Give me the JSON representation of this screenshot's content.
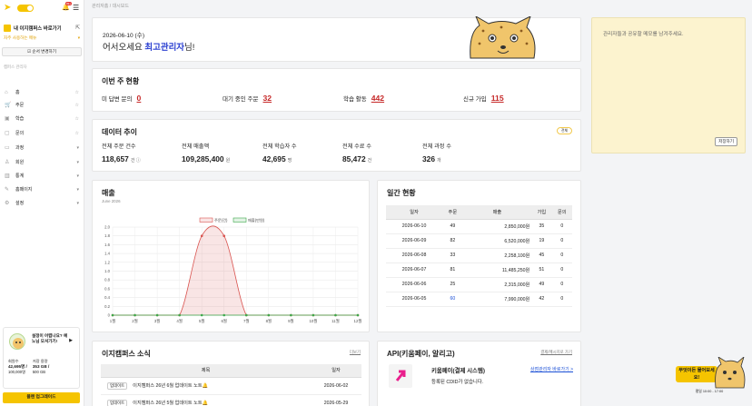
{
  "sidebar": {
    "notif_badge": "99+",
    "quick_label": "내 이지캠퍼스 바로가기",
    "fav_label": "자주 사용하는 메뉴",
    "sort_button": "☑ 순서 변경하기",
    "section_label": "캠퍼스 관리자",
    "items": [
      {
        "icon": "home-icon",
        "glyph": "⌂",
        "label": "홈",
        "right": "☆"
      },
      {
        "icon": "cart-icon",
        "glyph": "🛒",
        "label": "주문",
        "right": "☆"
      },
      {
        "icon": "book-icon",
        "glyph": "▣",
        "label": "학습",
        "right": "☆"
      },
      {
        "icon": "chat-icon",
        "glyph": "▢",
        "label": "문의",
        "right": "☆"
      },
      {
        "icon": "folder-icon",
        "glyph": "▭",
        "label": "과정",
        "right": "▾"
      },
      {
        "icon": "user-icon",
        "glyph": "♙",
        "label": "회원",
        "right": "▾"
      },
      {
        "icon": "stats-icon",
        "glyph": "▥",
        "label": "통계",
        "right": "▾"
      },
      {
        "icon": "pen-icon",
        "glyph": "✎",
        "label": "홈페이지",
        "right": "▾"
      },
      {
        "icon": "gear-icon",
        "glyph": "⚙",
        "label": "설정",
        "right": "▾"
      }
    ],
    "promo": {
      "text": "설정이 어렵나요? 예노님 모셔가기!",
      "members_label": "회원수",
      "members_value": "42,695명 /",
      "members_cap": "100,000명",
      "storage_label": "저장 용량",
      "storage_value": "353 GB /",
      "storage_cap": "500 GB"
    },
    "upgrade": "플랜 업그레이드"
  },
  "breadcrumb": {
    "root": "관리자홈",
    "sep": "/",
    "current": "대시보드"
  },
  "welcome": {
    "date": "2026-06-10 (수)",
    "prefix": "어서오세요 ",
    "name": "최고관리자",
    "suffix": "님!"
  },
  "weekly": {
    "title": "이번 주 현황",
    "items": [
      {
        "label": "미 답변 문의",
        "value": "0"
      },
      {
        "label": "대기 중인 주문",
        "value": "32"
      },
      {
        "label": "학습 활동",
        "value": "442"
      },
      {
        "label": "신규 가입",
        "value": "115"
      }
    ]
  },
  "trend": {
    "title": "데이터 추이",
    "pill": "전체",
    "items": [
      {
        "label": "전체 주문 건수",
        "value": "118,657",
        "unit": "건 ⓘ"
      },
      {
        "label": "전체 매출액",
        "value": "109,285,400",
        "unit": "원"
      },
      {
        "label": "전체 학습자 수",
        "value": "42,695",
        "unit": "명"
      },
      {
        "label": "전체 수료 수",
        "value": "85,472",
        "unit": "건"
      },
      {
        "label": "전체 과정 수",
        "value": "326",
        "unit": "개"
      }
    ]
  },
  "memo": {
    "placeholder": "관리자들과 공유할 메모를 남겨주세요.",
    "save": "저장하기"
  },
  "sales": {
    "title": "매출",
    "subtitle": "June 2026"
  },
  "chart_data": {
    "type": "area",
    "categories": [
      "1월",
      "2월",
      "3월",
      "4월",
      "5월",
      "6월",
      "7월",
      "8월",
      "9월",
      "10월",
      "11월",
      "12월"
    ],
    "ylim": [
      0,
      2
    ],
    "yticks": [
      "0",
      "0.2",
      "0.4",
      "0.6",
      "0.8",
      "1.0",
      "1.2",
      "1.4",
      "1.6",
      "1.8",
      "2.0"
    ],
    "series": [
      {
        "name": "주문(건)",
        "color": "#d9534f",
        "values": [
          0,
          0,
          0,
          0,
          1.8,
          1.8,
          0,
          0,
          0,
          0,
          0,
          0
        ]
      },
      {
        "name": "매출(만원)",
        "color": "#3ca84a",
        "values": [
          0,
          0,
          0,
          0,
          0,
          0,
          0,
          0,
          0,
          0,
          0,
          0
        ]
      }
    ],
    "legend": "top-center",
    "grid": true
  },
  "daily": {
    "title": "일간 현황",
    "headers": [
      "일자",
      "주문",
      "매출",
      "가입",
      "문의"
    ],
    "rows": [
      [
        "2026-06-10",
        "49",
        "2,850,000원",
        "35",
        "0"
      ],
      [
        "2026-06-09",
        "82",
        "6,520,000원",
        "19",
        "0"
      ],
      [
        "2026-06-08",
        "33",
        "2,258,100원",
        "45",
        "0"
      ],
      [
        "2026-06-07",
        "81",
        "11,485,250원",
        "51",
        "0"
      ],
      [
        "2026-06-06",
        "25",
        "2,315,000원",
        "49",
        "0"
      ],
      [
        "2026-06-05",
        "60",
        "7,990,000원",
        "42",
        "0"
      ]
    ]
  },
  "news": {
    "title": "이지캠퍼스 소식",
    "more": "더보기",
    "headers": [
      "제목",
      "일자"
    ],
    "rows": [
      {
        "tag": "업데이트",
        "title": "이지캠퍼스 26년 6월 업데이트 노트🔔",
        "date": "2026-06-02"
      },
      {
        "tag": "업데이트",
        "title": "이지캠퍼스 26년 5월 업데이트 노트🔔",
        "date": "2026-05-29"
      }
    ]
  },
  "api": {
    "title": "API(키움페이, 알리고)",
    "more": "결제/메시지로 가기",
    "name": "키움페이(결제 시스템)",
    "status": "등록된 CDID가 없습니다.",
    "link": "상점관리자 바로가기 >"
  },
  "float": {
    "text": "무엇이든 물어보세요!",
    "hours": "평일 10:00 - 17:00"
  }
}
